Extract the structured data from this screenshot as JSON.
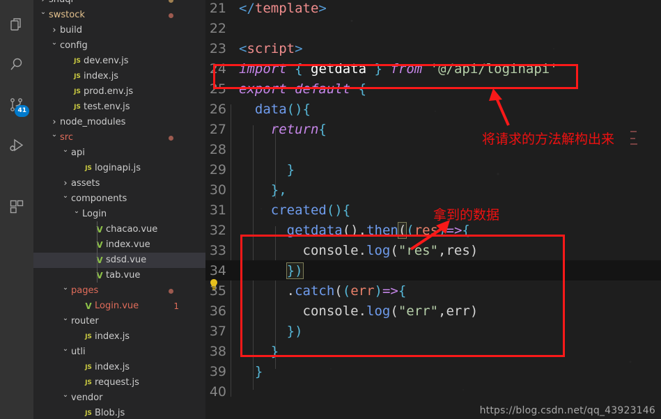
{
  "activity_bar": {
    "items": [
      {
        "name": "explorer-icon",
        "label": "Explorer",
        "badge": ""
      },
      {
        "name": "search-icon",
        "label": "Search",
        "badge": ""
      },
      {
        "name": "source-control-icon",
        "label": "Source Control",
        "badge": "41"
      },
      {
        "name": "run-debug-icon",
        "label": "Run and Debug",
        "badge": ""
      },
      {
        "name": "extensions-icon",
        "label": "Extensions",
        "badge": ""
      }
    ]
  },
  "sidebar": {
    "items": [
      {
        "label": "shuqi",
        "indent": 1,
        "chev": "closed",
        "icon": "none",
        "color": "#cccccc",
        "dot": "#a08050",
        "count": "",
        "selected": false,
        "clipped_top": true
      },
      {
        "label": "swstock",
        "indent": 1,
        "chev": "open",
        "icon": "none",
        "color": "#e2c08d",
        "dot": "#9d5a4f",
        "count": "",
        "selected": false
      },
      {
        "label": "build",
        "indent": 2,
        "chev": "closed",
        "icon": "none",
        "color": "#cccccc",
        "dot": "",
        "count": "",
        "selected": false
      },
      {
        "label": "config",
        "indent": 2,
        "chev": "open",
        "icon": "none",
        "color": "#cccccc",
        "dot": "",
        "count": "",
        "selected": false
      },
      {
        "label": "dev.env.js",
        "indent": 3,
        "chev": "blank",
        "icon": "js",
        "color": "#cccccc",
        "dot": "",
        "count": "",
        "selected": false
      },
      {
        "label": "index.js",
        "indent": 3,
        "chev": "blank",
        "icon": "js",
        "color": "#cccccc",
        "dot": "",
        "count": "",
        "selected": false
      },
      {
        "label": "prod.env.js",
        "indent": 3,
        "chev": "blank",
        "icon": "js",
        "color": "#cccccc",
        "dot": "",
        "count": "",
        "selected": false
      },
      {
        "label": "test.env.js",
        "indent": 3,
        "chev": "blank",
        "icon": "js",
        "color": "#cccccc",
        "dot": "",
        "count": "",
        "selected": false
      },
      {
        "label": "node_modules",
        "indent": 2,
        "chev": "closed",
        "icon": "none",
        "color": "#cccccc",
        "dot": "",
        "count": "",
        "selected": false
      },
      {
        "label": "src",
        "indent": 2,
        "chev": "open",
        "icon": "none",
        "color": "#e06c5a",
        "dot": "#9d5a4f",
        "count": "",
        "selected": false
      },
      {
        "label": "api",
        "indent": 3,
        "chev": "open",
        "icon": "none",
        "color": "#cccccc",
        "dot": "",
        "count": "",
        "selected": false
      },
      {
        "label": "loginapi.js",
        "indent": 4,
        "chev": "blank",
        "icon": "js",
        "color": "#cccccc",
        "dot": "",
        "count": "",
        "selected": false
      },
      {
        "label": "assets",
        "indent": 3,
        "chev": "closed",
        "icon": "none",
        "color": "#cccccc",
        "dot": "",
        "count": "",
        "selected": false
      },
      {
        "label": "components",
        "indent": 3,
        "chev": "open",
        "icon": "none",
        "color": "#cccccc",
        "dot": "",
        "count": "",
        "selected": false
      },
      {
        "label": "Login",
        "indent": 4,
        "chev": "open",
        "icon": "none",
        "color": "#cccccc",
        "dot": "",
        "count": "",
        "selected": false
      },
      {
        "label": "chacao.vue",
        "indent": 5,
        "chev": "blank",
        "icon": "vue",
        "color": "#cccccc",
        "dot": "",
        "count": "",
        "selected": false
      },
      {
        "label": "index.vue",
        "indent": 5,
        "chev": "blank",
        "icon": "vue",
        "color": "#cccccc",
        "dot": "",
        "count": "",
        "selected": false
      },
      {
        "label": "sdsd.vue",
        "indent": 5,
        "chev": "blank",
        "icon": "vue",
        "color": "#cccccc",
        "dot": "",
        "count": "",
        "selected": true
      },
      {
        "label": "tab.vue",
        "indent": 5,
        "chev": "blank",
        "icon": "vue",
        "color": "#cccccc",
        "dot": "",
        "count": "",
        "selected": false
      },
      {
        "label": "pages",
        "indent": 3,
        "chev": "open",
        "icon": "none",
        "color": "#e06c5a",
        "dot": "#9d5a4f",
        "count": "",
        "selected": false
      },
      {
        "label": "Login.vue",
        "indent": 4,
        "chev": "blank",
        "icon": "vue",
        "color": "#e06c5a",
        "dot": "",
        "count": "1",
        "selected": false
      },
      {
        "label": "router",
        "indent": 3,
        "chev": "open",
        "icon": "none",
        "color": "#cccccc",
        "dot": "",
        "count": "",
        "selected": false
      },
      {
        "label": "index.js",
        "indent": 4,
        "chev": "blank",
        "icon": "js",
        "color": "#cccccc",
        "dot": "",
        "count": "",
        "selected": false
      },
      {
        "label": "utli",
        "indent": 3,
        "chev": "open",
        "icon": "none",
        "color": "#cccccc",
        "dot": "",
        "count": "",
        "selected": false
      },
      {
        "label": "index.js",
        "indent": 4,
        "chev": "blank",
        "icon": "js",
        "color": "#cccccc",
        "dot": "",
        "count": "",
        "selected": false
      },
      {
        "label": "request.js",
        "indent": 4,
        "chev": "blank",
        "icon": "js",
        "color": "#cccccc",
        "dot": "",
        "count": "",
        "selected": false
      },
      {
        "label": "vendor",
        "indent": 3,
        "chev": "open",
        "icon": "none",
        "color": "#cccccc",
        "dot": "",
        "count": "",
        "selected": false
      },
      {
        "label": "Blob.js",
        "indent": 4,
        "chev": "blank",
        "icon": "js",
        "color": "#cccccc",
        "dot": "",
        "count": "",
        "selected": false
      }
    ]
  },
  "editor": {
    "first_line_number": 21,
    "active_line_number": 34,
    "lightbulb_line_number": 34,
    "lines": [
      {
        "n": 21,
        "tokens": [
          {
            "t": "</",
            "c": "t-tag"
          },
          {
            "t": "template",
            "c": "t-tagname"
          },
          {
            "t": ">",
            "c": "t-tag"
          }
        ]
      },
      {
        "n": 22,
        "tokens": []
      },
      {
        "n": 23,
        "tokens": [
          {
            "t": "<",
            "c": "t-tag"
          },
          {
            "t": "script",
            "c": "t-tagname"
          },
          {
            "t": ">",
            "c": "t-tag"
          }
        ]
      },
      {
        "n": 24,
        "tokens": [
          {
            "t": "import",
            "c": "t-kw"
          },
          {
            "t": " ",
            "c": "t-plain"
          },
          {
            "t": "{",
            "c": "t-punc"
          },
          {
            "t": " ",
            "c": "t-plain"
          },
          {
            "t": "getdata",
            "c": "t-ident"
          },
          {
            "t": " ",
            "c": "t-plain"
          },
          {
            "t": "}",
            "c": "t-punc"
          },
          {
            "t": " ",
            "c": "t-plain"
          },
          {
            "t": "from",
            "c": "t-kw"
          },
          {
            "t": " ",
            "c": "t-plain"
          },
          {
            "t": "'@/api/loginapi'",
            "c": "t-str"
          }
        ]
      },
      {
        "n": 25,
        "tokens": [
          {
            "t": "export",
            "c": "t-kw"
          },
          {
            "t": " ",
            "c": "t-plain"
          },
          {
            "t": "default",
            "c": "t-kw"
          },
          {
            "t": " ",
            "c": "t-plain"
          },
          {
            "t": "{",
            "c": "t-punc"
          }
        ]
      },
      {
        "n": 26,
        "tokens": [
          {
            "t": "  ",
            "c": "t-plain"
          },
          {
            "t": "data",
            "c": "t-fn"
          },
          {
            "t": "(){",
            "c": "t-punc"
          }
        ]
      },
      {
        "n": 27,
        "tokens": [
          {
            "t": "    ",
            "c": "t-plain"
          },
          {
            "t": "return",
            "c": "t-kw"
          },
          {
            "t": "{",
            "c": "t-punc"
          }
        ]
      },
      {
        "n": 28,
        "tokens": []
      },
      {
        "n": 29,
        "tokens": [
          {
            "t": "      ",
            "c": "t-plain"
          },
          {
            "t": "}",
            "c": "t-punc"
          }
        ]
      },
      {
        "n": 30,
        "tokens": [
          {
            "t": "    ",
            "c": "t-plain"
          },
          {
            "t": "},",
            "c": "t-punc"
          }
        ]
      },
      {
        "n": 31,
        "tokens": [
          {
            "t": "    ",
            "c": "t-plain"
          },
          {
            "t": "created",
            "c": "t-fn"
          },
          {
            "t": "(){",
            "c": "t-punc"
          }
        ]
      },
      {
        "n": 32,
        "tokens": [
          {
            "t": "      ",
            "c": "t-plain"
          },
          {
            "t": "getdata",
            "c": "t-fn"
          },
          {
            "t": "()",
            "c": "t-plain"
          },
          {
            "t": ".",
            "c": "t-plain"
          },
          {
            "t": "then",
            "c": "t-fn"
          },
          {
            "t": "(",
            "c": "t-plain"
          },
          {
            "t": "(",
            "c": "t-punc"
          },
          {
            "t": "res",
            "c": "t-param"
          },
          {
            "t": ")",
            "c": "t-punc"
          },
          {
            "t": "=>",
            "c": "t-kw"
          },
          {
            "t": "{",
            "c": "t-punc"
          }
        ]
      },
      {
        "n": 33,
        "tokens": [
          {
            "t": "        ",
            "c": "t-plain"
          },
          {
            "t": "console",
            "c": "t-plain"
          },
          {
            "t": ".",
            "c": "t-plain"
          },
          {
            "t": "log",
            "c": "t-fn"
          },
          {
            "t": "(",
            "c": "t-plain"
          },
          {
            "t": "\"res\"",
            "c": "t-str"
          },
          {
            "t": ",",
            "c": "t-plain"
          },
          {
            "t": "res",
            "c": "t-plain"
          },
          {
            "t": ")",
            "c": "t-plain"
          }
        ]
      },
      {
        "n": 34,
        "tokens": [
          {
            "t": "      ",
            "c": "t-plain"
          },
          {
            "t": "})",
            "c": "t-punc"
          }
        ]
      },
      {
        "n": 35,
        "tokens": [
          {
            "t": "      ",
            "c": "t-plain"
          },
          {
            "t": ".",
            "c": "t-plain"
          },
          {
            "t": "catch",
            "c": "t-fn"
          },
          {
            "t": "(",
            "c": "t-plain"
          },
          {
            "t": "(",
            "c": "t-punc"
          },
          {
            "t": "err",
            "c": "t-param"
          },
          {
            "t": ")",
            "c": "t-punc"
          },
          {
            "t": "=>",
            "c": "t-kw"
          },
          {
            "t": "{",
            "c": "t-punc"
          }
        ]
      },
      {
        "n": 36,
        "tokens": [
          {
            "t": "        ",
            "c": "t-plain"
          },
          {
            "t": "console",
            "c": "t-plain"
          },
          {
            "t": ".",
            "c": "t-plain"
          },
          {
            "t": "log",
            "c": "t-fn"
          },
          {
            "t": "(",
            "c": "t-plain"
          },
          {
            "t": "\"err\"",
            "c": "t-str"
          },
          {
            "t": ",",
            "c": "t-plain"
          },
          {
            "t": "err",
            "c": "t-plain"
          },
          {
            "t": ")",
            "c": "t-plain"
          }
        ]
      },
      {
        "n": 37,
        "tokens": [
          {
            "t": "      ",
            "c": "t-plain"
          },
          {
            "t": "})",
            "c": "t-punc"
          }
        ]
      },
      {
        "n": 38,
        "tokens": [
          {
            "t": "    ",
            "c": "t-plain"
          },
          {
            "t": "}",
            "c": "t-punc"
          }
        ]
      },
      {
        "n": 39,
        "tokens": [
          {
            "t": "  ",
            "c": "t-plain"
          },
          {
            "t": "}",
            "c": "t-punc"
          }
        ]
      },
      {
        "n": 40,
        "tokens": []
      }
    ]
  },
  "annotations": {
    "color": "#fa1919",
    "import_box_label": "import-line-highlight",
    "then_box_label": "promise-block-highlight",
    "note_import": "将请求的方法解构出来",
    "note_data": "拿到的数据"
  },
  "watermark": {
    "text": "https://blog.csdn.net/qq_43923146"
  }
}
